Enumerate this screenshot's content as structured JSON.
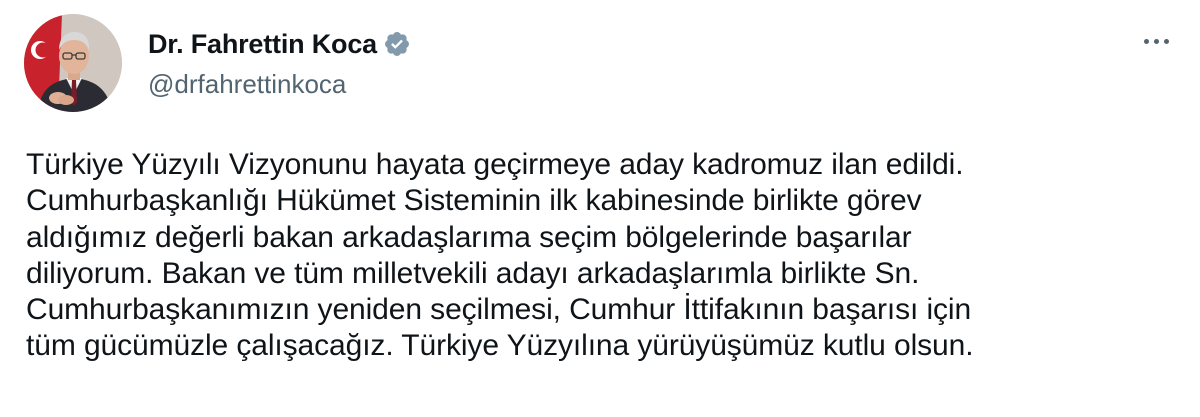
{
  "author": {
    "display_name": "Dr. Fahrettin Koca",
    "handle": "@drfahrettinkoca",
    "verified": true,
    "verified_icon": "verified-badge-icon",
    "avatar_icon": "profile-photo"
  },
  "menu": {
    "more_icon": "more-horizontal-icon"
  },
  "tweet": {
    "lines": [
      "Türkiye Yüzyılı Vizyonunu hayata geçirmeye aday kadromuz ilan edildi.",
      "Cumhurbaşkanlığı Hükümet Sisteminin ilk kabinesinde birlikte görev",
      "aldığımız değerli bakan arkadaşlarıma seçim bölgelerinde başarılar",
      "diliyorum. Bakan ve tüm milletvekili adayı arkadaşlarımla birlikte Sn.",
      "Cumhurbaşkanımızın yeniden seçilmesi, Cumhur İttifakının başarısı için",
      "tüm gücümüzle çalışacağız. Türkiye Yüzyılına yürüyüşümüz kutlu olsun."
    ]
  },
  "colors": {
    "text_primary": "#0f1419",
    "text_secondary": "#536471",
    "verified_badge": "#829aab",
    "background": "#ffffff"
  }
}
